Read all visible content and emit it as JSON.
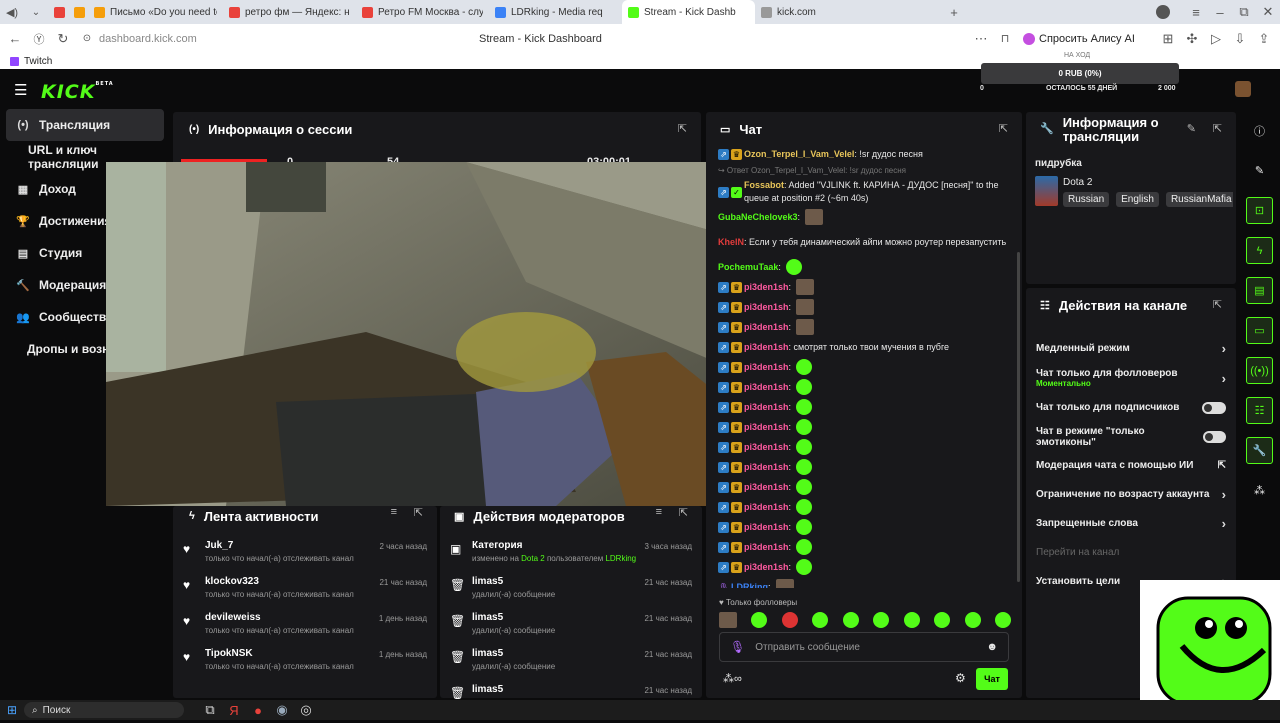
{
  "browser": {
    "tabs": [
      {
        "label": "",
        "color": "#e9423b"
      },
      {
        "label": "",
        "color": "#f59e0b"
      },
      {
        "label": "Письмо «Do you need to",
        "color": "#f59e0b"
      },
      {
        "label": "ретро фм — Яндекс: наш",
        "color": "#e9423b"
      },
      {
        "label": "Ретро FM Москва - слуш",
        "color": "#e9423b"
      },
      {
        "label": "LDRking - Media req",
        "color": "#3b82f6"
      },
      {
        "label": "Stream - Kick Dashb",
        "color": "#53fc18"
      },
      {
        "label": "kick.com",
        "color": "#999999"
      }
    ],
    "url": "dashboard.kick.com",
    "page_title": "Stream - Kick Dashboard",
    "alice_label": "Спросить Алису AI",
    "bookmark": "Twitch"
  },
  "header": {
    "logo": "KICK",
    "logo_beta": "BETA",
    "goal_title": "НА ХОД",
    "goal_amount": "0 RUB (0%)",
    "goal_min": "0",
    "goal_remaining": "ОСТАЛОСЬ 55 ДНЕЙ",
    "goal_max": "2 000"
  },
  "sidebar": {
    "items": [
      {
        "label": "Трансляция",
        "icon": "(•)"
      },
      {
        "label": "URL и ключ трансляции",
        "icon": ""
      },
      {
        "label": "Доход",
        "icon": "▦"
      },
      {
        "label": "Достижения",
        "icon": "🏆"
      },
      {
        "label": "Студия",
        "icon": "▤"
      },
      {
        "label": "Модерация",
        "icon": "🔨"
      },
      {
        "label": "Сообщество",
        "icon": "👥"
      },
      {
        "label": "Дропы и возна",
        "icon": ""
      }
    ]
  },
  "session": {
    "title": "Информация о сессии",
    "stats": [
      "0",
      "54",
      "",
      "03:00:01"
    ]
  },
  "activity": {
    "title": "Лента активности",
    "rows": [
      {
        "name": "Juk_7",
        "sub": "только что начал(-а) отслеживать канал",
        "time": "2 часа назад"
      },
      {
        "name": "klockov323",
        "sub": "только что начал(-а) отслеживать канал",
        "time": "21 час назад"
      },
      {
        "name": "devileweiss",
        "sub": "только что начал(-а) отслеживать канал",
        "time": "1 день назад"
      },
      {
        "name": "TipokNSK",
        "sub": "только что начал(-а) отслеживать канал",
        "time": "1 день назад"
      }
    ]
  },
  "modactions": {
    "title": "Действия модераторов",
    "first": {
      "name": "Категория",
      "sub_pre": "изменено на ",
      "sub_game": "Dota 2",
      "sub_mid": " пользователем ",
      "sub_user": "LDRking",
      "time": "3 часа назад"
    },
    "rows": [
      {
        "name": "limas5",
        "sub": "удалил(-а) сообщение",
        "time": "21 час назад"
      },
      {
        "name": "limas5",
        "sub": "удалил(-а) сообщение",
        "time": "21 час назад"
      },
      {
        "name": "limas5",
        "sub": "удалил(-а) сообщение",
        "time": "21 час назад"
      },
      {
        "name": "limas5",
        "sub": "",
        "time": "21 час назад"
      }
    ]
  },
  "chat": {
    "title": "Чат",
    "messages": [
      {
        "user": "Ozon_Terpel_I_Vam_Velel",
        "color": "#e8c55a",
        "text": ": !sr дудос песня",
        "emotes": 0
      },
      {
        "reply": "↪ Ответ Ozon_Terpel_I_Vam_Velel: !sr дудос песня"
      },
      {
        "user": "Fossabot",
        "color": "#e8c55a",
        "text": ": Added \"VJLINK ft. КАРИНА - ДУДОС [песня]\" to the queue at position #2 (~6m 40s)",
        "emotes": 0
      },
      {
        "user": "GubaNeChelovek3",
        "color": "#53fc18",
        "text": ":",
        "emotes": 1,
        "img": true
      },
      {
        "user": "KhelN",
        "color": "#e23c3c",
        "text": ": Если у тебя динамический айпи можно роутер перезапустить",
        "emotes": 0
      },
      {
        "user": "PochemuTaak",
        "color": "#53fc18",
        "text": ":",
        "emotes": 1
      },
      {
        "user": "pi3den1sh",
        "color": "#ff5aa0",
        "text": ":",
        "emotes": 1,
        "img": true
      },
      {
        "user": "pi3den1sh",
        "color": "#ff5aa0",
        "text": ":",
        "emotes": 1,
        "img": true
      },
      {
        "user": "pi3den1sh",
        "color": "#ff5aa0",
        "text": ":",
        "emotes": 1,
        "img": true
      },
      {
        "user": "pi3den1sh",
        "color": "#ff5aa0",
        "text": ": смотрят только твои мучения в пубге",
        "emotes": 0
      },
      {
        "user": "pi3den1sh",
        "color": "#ff5aa0",
        "text": ":",
        "emotes": 1
      },
      {
        "user": "pi3den1sh",
        "color": "#ff5aa0",
        "text": ":",
        "emotes": 1
      },
      {
        "user": "pi3den1sh",
        "color": "#ff5aa0",
        "text": ":",
        "emotes": 1
      },
      {
        "user": "pi3den1sh",
        "color": "#ff5aa0",
        "text": ":",
        "emotes": 1
      },
      {
        "user": "pi3den1sh",
        "color": "#ff5aa0",
        "text": ":",
        "emotes": 1
      },
      {
        "user": "pi3den1sh",
        "color": "#ff5aa0",
        "text": ":",
        "emotes": 1
      },
      {
        "user": "pi3den1sh",
        "color": "#ff5aa0",
        "text": ":",
        "emotes": 1
      },
      {
        "user": "pi3den1sh",
        "color": "#ff5aa0",
        "text": ":",
        "emotes": 1
      },
      {
        "user": "pi3den1sh",
        "color": "#ff5aa0",
        "text": ":",
        "emotes": 1
      },
      {
        "user": "pi3den1sh",
        "color": "#ff5aa0",
        "text": ":",
        "emotes": 1
      },
      {
        "user": "pi3den1sh",
        "color": "#ff5aa0",
        "text": ":",
        "emotes": 1
      },
      {
        "user": "LDRking",
        "color": "#3b82f6",
        "text": ":",
        "emotes": 1,
        "img": true
      }
    ],
    "followers_only": "Только фолловеры",
    "placeholder": "Отправить сообщение",
    "send_label": "Чат"
  },
  "stream_info": {
    "title": "Информация о трансляции",
    "stream_title": "пидрубка",
    "category": "Dota 2",
    "tags": [
      "Russian",
      "English",
      "RussianMafia"
    ]
  },
  "channel_actions": {
    "title": "Действия на канале",
    "rows": [
      {
        "label": "Медленный режим",
        "sub": "",
        "control": "chevron"
      },
      {
        "label": "Чат только для фолловеров",
        "sub": "Моментально",
        "control": "chevron"
      },
      {
        "label": "Чат только для подписчиков",
        "sub": "",
        "control": "toggle"
      },
      {
        "label": "Чат в режиме \"только эмотиконы\"",
        "sub": "",
        "control": "toggle"
      },
      {
        "label": "Модерация чата с помощью ИИ",
        "sub": "",
        "control": "external"
      },
      {
        "label": "Ограничение по возрасту аккаунта",
        "sub": "",
        "control": "chevron"
      },
      {
        "label": "Запрещенные слова",
        "sub": "",
        "control": "chevron"
      },
      {
        "label": "Перейти на канал",
        "sub": "",
        "control": "none",
        "dim": true
      },
      {
        "label": "Установить цели",
        "sub": "",
        "control": "chevron"
      }
    ]
  },
  "taskbar": {
    "search": "Поиск"
  }
}
